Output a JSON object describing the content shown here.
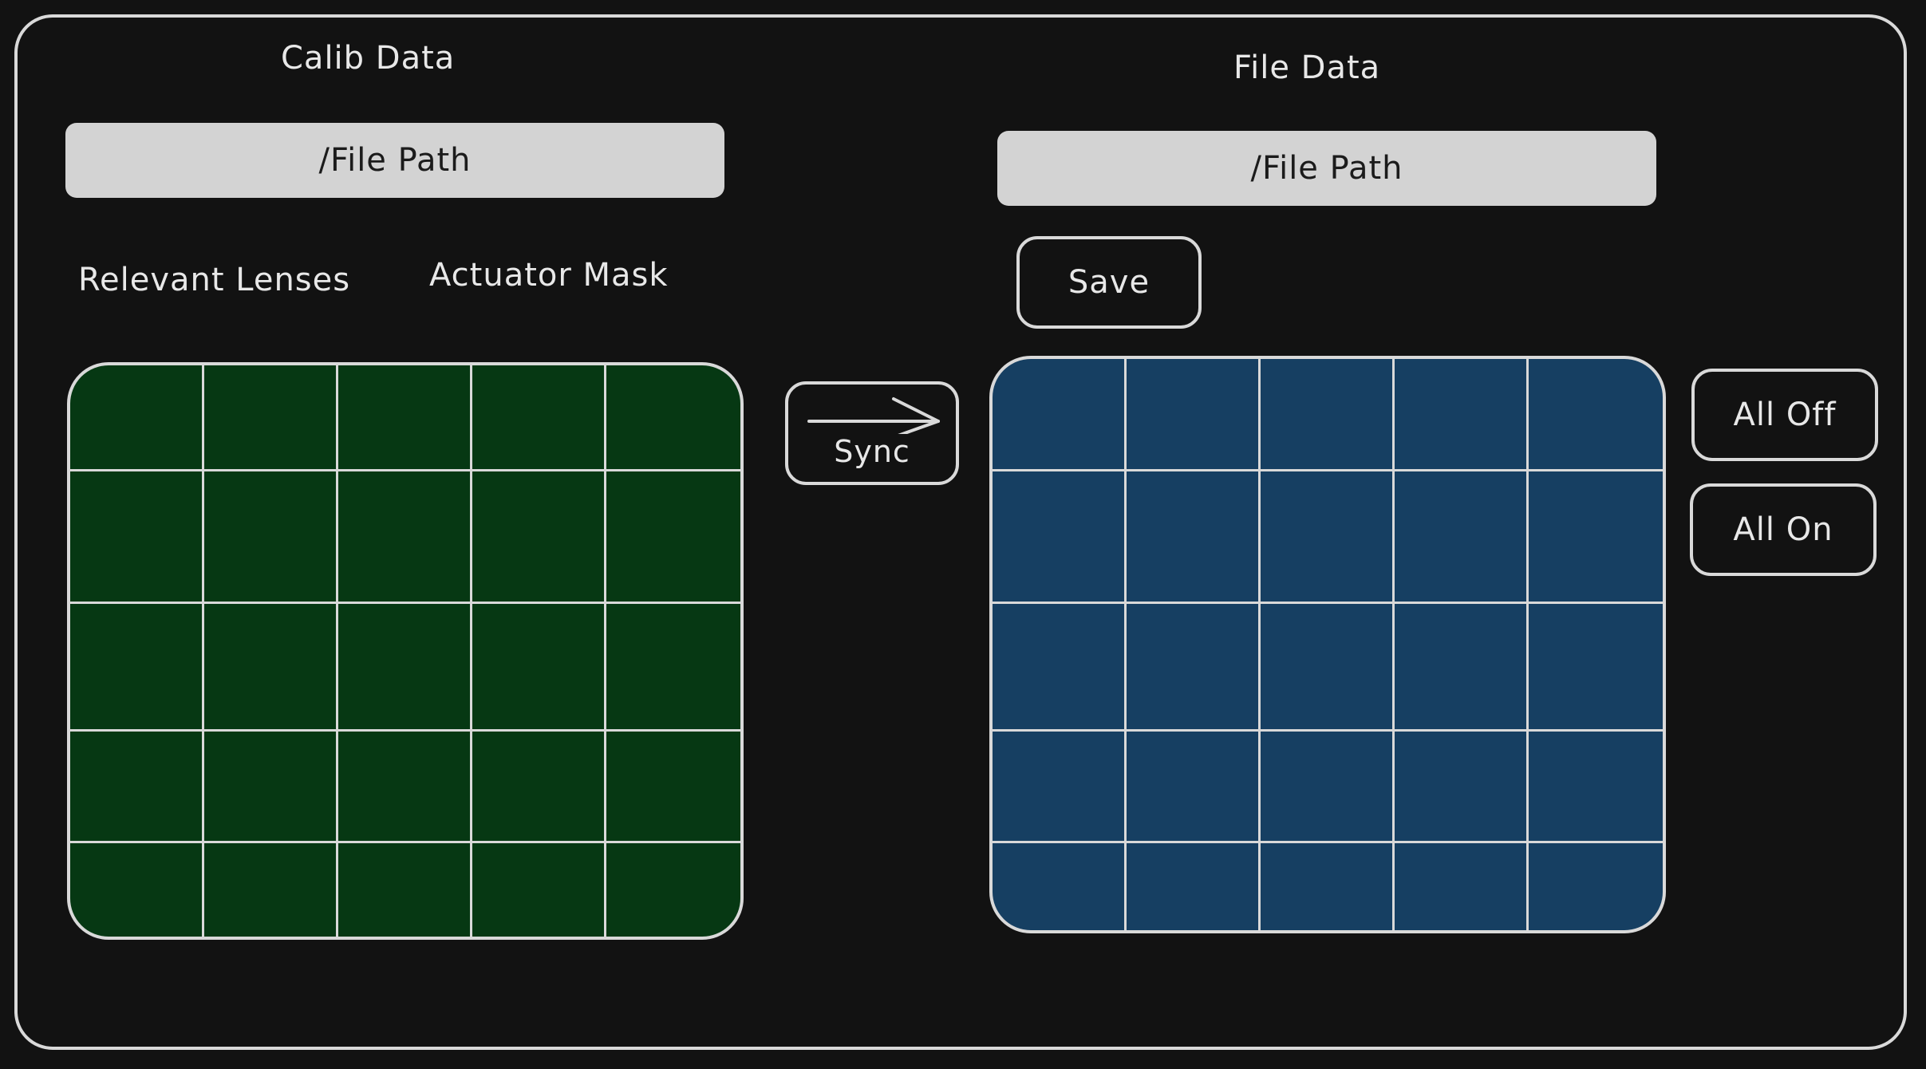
{
  "left_panel": {
    "title": "Calib Data",
    "file_path": "/File Path",
    "relevant_lenses_label": "Relevant Lenses",
    "actuator_mask_label": "Actuator Mask",
    "grid_color": "#063813",
    "grid_rows": 5,
    "grid_cols": 5
  },
  "sync_button": {
    "label": "Sync",
    "icon": "arrow-right-icon"
  },
  "right_panel": {
    "title": "File Data",
    "file_path": "/File Path",
    "save_label": "Save",
    "grid_color": "#163f62",
    "grid_rows": 5,
    "grid_cols": 5
  },
  "side_buttons": {
    "all_off_label": "All Off",
    "all_on_label": "All On"
  },
  "colors": {
    "background": "#121212",
    "stroke": "#d9d9d9",
    "path_field": "#d3d3d3",
    "left_grid": "#063813",
    "right_grid": "#163f62"
  }
}
